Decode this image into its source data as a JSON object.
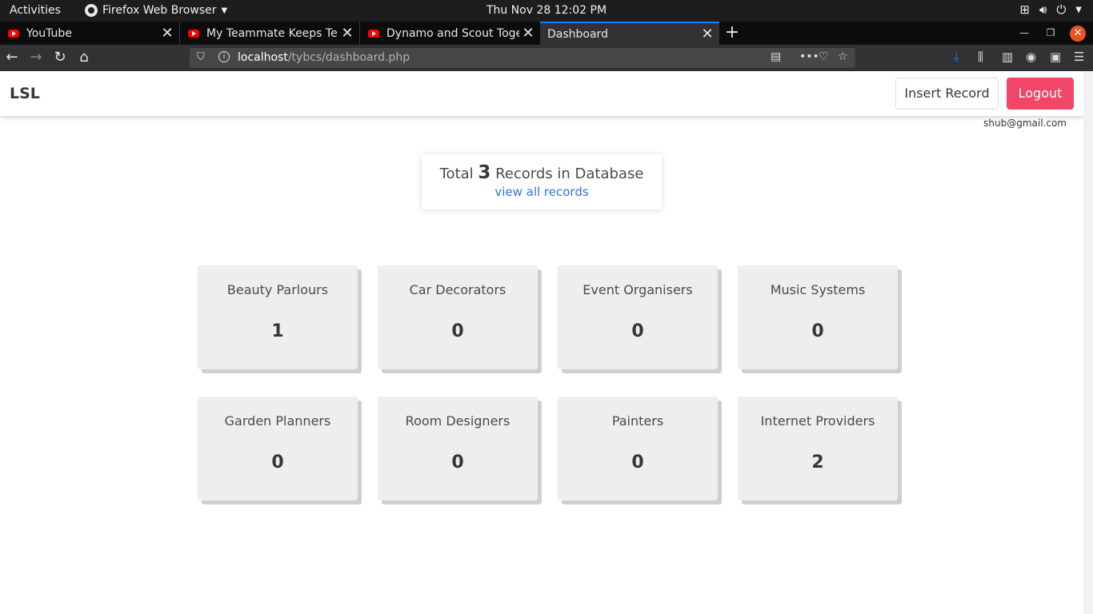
{
  "gnome_bar": {
    "activities": "Activities",
    "app_menu": "Firefox Web Browser",
    "clock": "Thu Nov 28  12:02 PM"
  },
  "browser": {
    "tabs": [
      {
        "title": "YouTube"
      },
      {
        "title": "My Teammate Keeps Tell"
      },
      {
        "title": "Dynamo and Scout Toget"
      },
      {
        "title": "Dashboard"
      }
    ],
    "url_host": "localhost",
    "url_path": "/tybcs/dashboard.php"
  },
  "header": {
    "brand": "LSL",
    "insert_label": "Insert Record",
    "logout_label": "Logout",
    "user_email": "shub@gmail.com"
  },
  "summary": {
    "prefix": "Total",
    "count": "3",
    "suffix": "Records in Database",
    "link": "view all records"
  },
  "categories": [
    {
      "label": "Beauty Parlours",
      "count": "1"
    },
    {
      "label": "Car Decorators",
      "count": "0"
    },
    {
      "label": "Event Organisers",
      "count": "0"
    },
    {
      "label": "Music Systems",
      "count": "0"
    },
    {
      "label": "Garden Planners",
      "count": "0"
    },
    {
      "label": "Room Designers",
      "count": "0"
    },
    {
      "label": "Painters",
      "count": "0"
    },
    {
      "label": "Internet Providers",
      "count": "2"
    }
  ],
  "colors": {
    "logout": "#f14668",
    "link": "#3273dc",
    "card_bg": "#eeeeee",
    "tab_accent": "#0a84ff"
  }
}
